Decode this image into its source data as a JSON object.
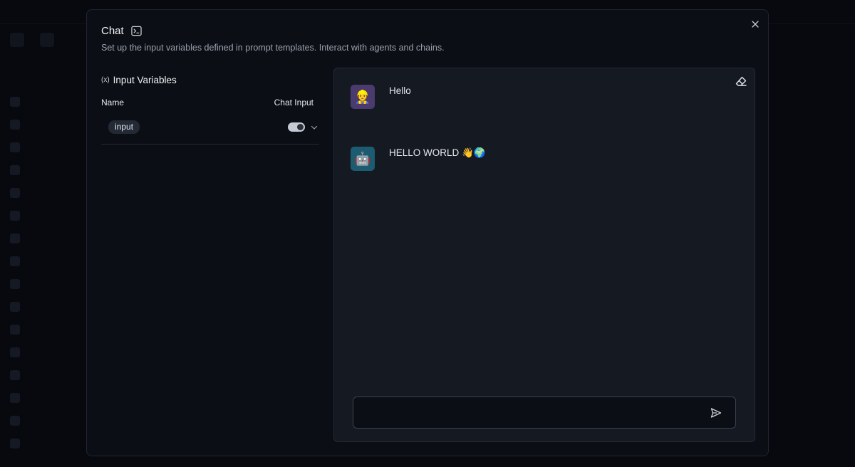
{
  "modal": {
    "title": "Chat",
    "title_icon": "terminal-icon",
    "description": "Set up the input variables defined in prompt templates. Interact with agents and chains.",
    "close_icon": "close-icon"
  },
  "input_variables": {
    "section_icon": "variable-icon",
    "section_icon_glyph": "(x)",
    "title": "Input Variables",
    "columns": {
      "name": "Name",
      "chat_input": "Chat Input"
    },
    "rows": [
      {
        "name": "input",
        "chat_input_enabled": true
      }
    ]
  },
  "chat": {
    "clear_icon": "eraser-icon",
    "messages": [
      {
        "role": "user",
        "avatar_emoji": "👷",
        "text": "Hello"
      },
      {
        "role": "bot",
        "avatar_emoji": "🤖",
        "text": "HELLO WORLD 👋🌍"
      }
    ],
    "input": {
      "value": "",
      "placeholder": ""
    },
    "send_icon": "send-icon"
  },
  "colors": {
    "modal_bg": "#0b0e15",
    "chat_panel_bg": "#151922",
    "user_avatar_bg": "#4a3a6e",
    "bot_avatar_bg": "#1c5b70"
  }
}
